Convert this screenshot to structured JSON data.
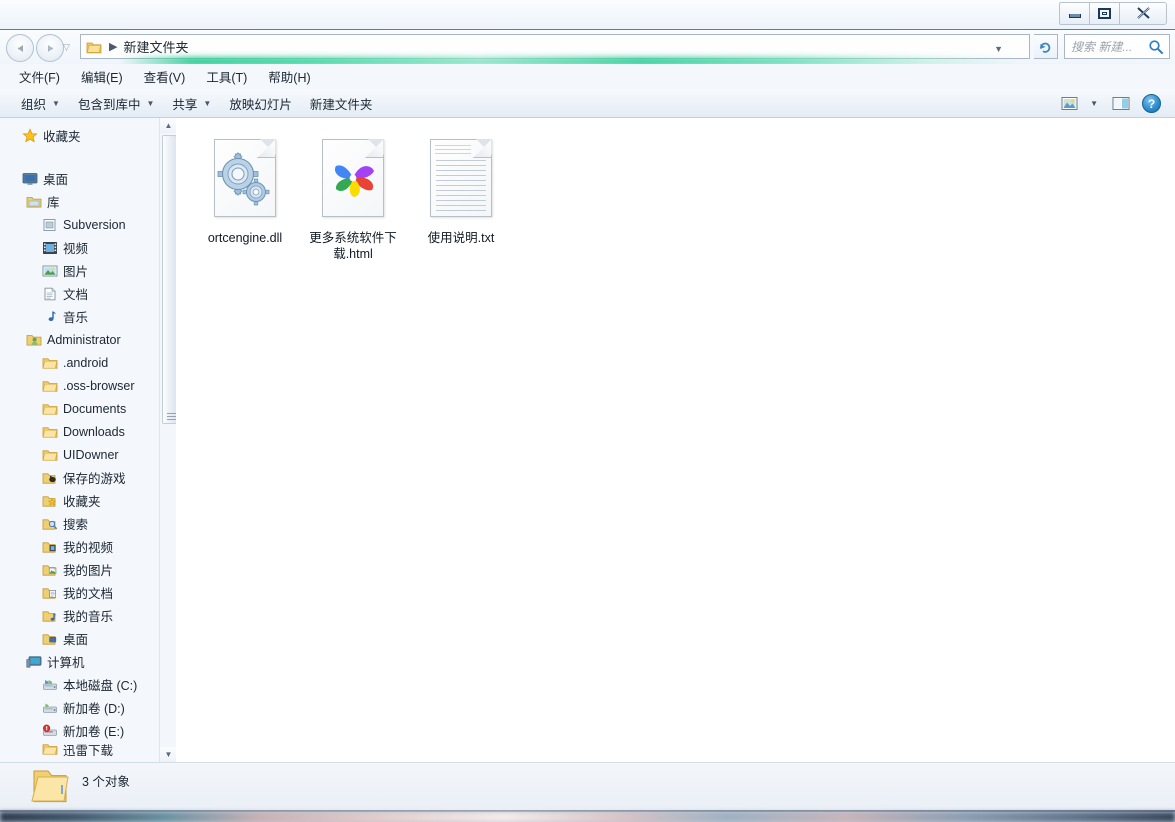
{
  "window": {
    "titlebar_buttons": [
      {
        "name": "minimize",
        "glyph": "—"
      },
      {
        "name": "maximize",
        "glyph": "❐"
      },
      {
        "name": "close",
        "glyph": "✕"
      }
    ]
  },
  "address_bar": {
    "back_glyph": "◄",
    "forward_glyph": "►",
    "history_glyph": "▽",
    "folder_icon": "folder-icon",
    "separator": "▶",
    "path": "新建文件夹",
    "path_dropdown_glyph": "▼",
    "refresh_glyph": "↻",
    "search_placeholder": "搜索 新建...",
    "search_icon": "search-icon"
  },
  "menu": {
    "items": [
      {
        "label": "文件(F)"
      },
      {
        "label": "编辑(E)"
      },
      {
        "label": "查看(V)"
      },
      {
        "label": "工具(T)"
      },
      {
        "label": "帮助(H)"
      }
    ]
  },
  "toolbar": {
    "items": [
      {
        "label": "组织",
        "caret": "▼"
      },
      {
        "label": "包含到库中",
        "caret": "▼"
      },
      {
        "label": "共享",
        "caret": "▼"
      },
      {
        "label": "放映幻灯片",
        "caret": ""
      },
      {
        "label": "新建文件夹",
        "caret": ""
      }
    ],
    "view_icon": "view-mode-icon",
    "view_caret": "▼",
    "preview_icon": "preview-pane-icon",
    "help_icon": "help-icon",
    "help_glyph": "?"
  },
  "sidebar": {
    "items": [
      {
        "label": "收藏夹",
        "icon": "star-icon",
        "indent": 0
      },
      {
        "label": "桌面",
        "icon": "desktop-icon",
        "indent": 0
      },
      {
        "label": "库",
        "icon": "library-icon",
        "indent": 1
      },
      {
        "label": "Subversion",
        "icon": "subversion-icon",
        "indent": 2
      },
      {
        "label": "视频",
        "icon": "video-library-icon",
        "indent": 2
      },
      {
        "label": "图片",
        "icon": "pictures-library-icon",
        "indent": 2
      },
      {
        "label": "文档",
        "icon": "documents-library-icon",
        "indent": 2
      },
      {
        "label": "音乐",
        "icon": "music-library-icon",
        "indent": 2
      },
      {
        "label": "Administrator",
        "icon": "user-folder-icon",
        "indent": 1
      },
      {
        "label": ".android",
        "icon": "folder-icon",
        "indent": 2
      },
      {
        "label": ".oss-browser",
        "icon": "folder-icon",
        "indent": 2
      },
      {
        "label": "Documents",
        "icon": "folder-icon",
        "indent": 2
      },
      {
        "label": "Downloads",
        "icon": "folder-icon",
        "indent": 2
      },
      {
        "label": "UIDowner",
        "icon": "folder-icon",
        "indent": 2
      },
      {
        "label": "保存的游戏",
        "icon": "saved-games-icon",
        "indent": 2
      },
      {
        "label": "收藏夹",
        "icon": "favorites-folder-icon",
        "indent": 2
      },
      {
        "label": "搜索",
        "icon": "searches-folder-icon",
        "indent": 2
      },
      {
        "label": "我的视频",
        "icon": "my-videos-icon",
        "indent": 2
      },
      {
        "label": "我的图片",
        "icon": "my-pictures-icon",
        "indent": 2
      },
      {
        "label": "我的文档",
        "icon": "my-documents-icon",
        "indent": 2
      },
      {
        "label": "我的音乐",
        "icon": "my-music-icon",
        "indent": 2
      },
      {
        "label": "桌面",
        "icon": "desktop-folder-icon",
        "indent": 2
      },
      {
        "label": "计算机",
        "icon": "computer-icon",
        "indent": 1
      },
      {
        "label": "本地磁盘 (C:)",
        "icon": "system-drive-icon",
        "indent": 2
      },
      {
        "label": "新加卷 (D:)",
        "icon": "drive-icon",
        "indent": 2
      },
      {
        "label": "新加卷 (E:)",
        "icon": "drive-full-icon",
        "indent": 2
      },
      {
        "label": "迅雷下载",
        "icon": "folder-icon",
        "indent": 2
      }
    ],
    "scroll_up_glyph": "▲",
    "scroll_down_glyph": "▼"
  },
  "files": [
    {
      "name": "ortcengine.dll",
      "icon": "dll-gears-icon"
    },
    {
      "name": "更多系统软件下载.html",
      "icon": "html-chrome-icon"
    },
    {
      "name": "使用说明.txt",
      "icon": "txt-notepad-icon"
    }
  ],
  "status": {
    "icon": "folder-icon",
    "text": "3 个对象"
  },
  "colors": {
    "accent": "#2f8fd0",
    "chrome_red": "#ea4335",
    "chrome_yellow": "#fbdc00",
    "chrome_green": "#34a853",
    "chrome_blue": "#4285f4",
    "chrome_purple": "#a142f4",
    "window_bg": "#f0f4fa",
    "content_bg": "#ffffff"
  }
}
